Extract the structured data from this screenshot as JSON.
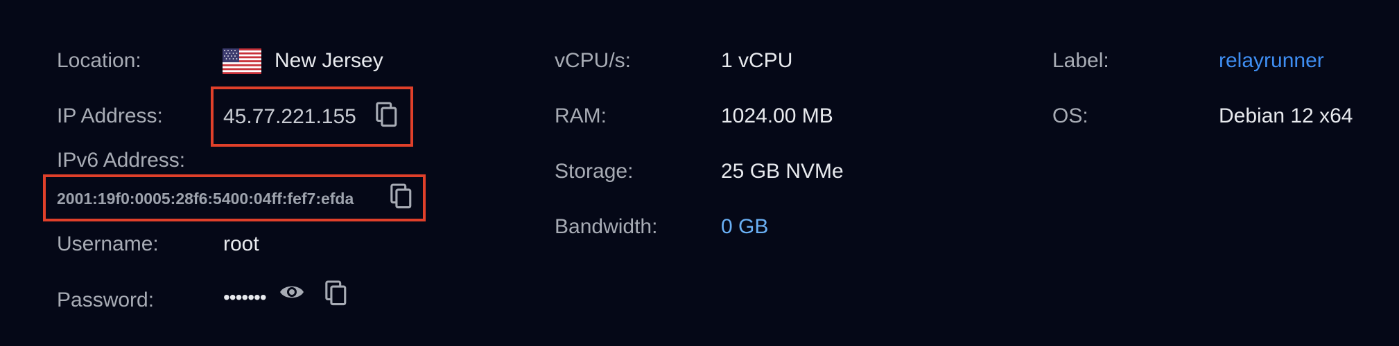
{
  "colors": {
    "background": "#050817",
    "label": "#a8acb5",
    "value": "#e8eaee",
    "link": "#3f8ef2",
    "bandwidth": "#6ab0f5",
    "highlight": "#e0402a"
  },
  "col1": {
    "location_label": "Location:",
    "location_flag_icon": "us-flag-icon",
    "location_value": "New Jersey",
    "ip_label": "IP Address:",
    "ip_value": "45.77.221.155",
    "ipv6_label": "IPv6 Address:",
    "ipv6_value": "2001:19f0:0005:28f6:5400:04ff:fef7:efda",
    "username_label": "Username:",
    "username_value": "root",
    "password_label": "Password:",
    "password_value": "•••••••"
  },
  "col2": {
    "vcpu_label": "vCPU/s:",
    "vcpu_value": "1 vCPU",
    "ram_label": "RAM:",
    "ram_value": "1024.00 MB",
    "storage_label": "Storage:",
    "storage_value": "25 GB NVMe",
    "bandwidth_label": "Bandwidth:",
    "bandwidth_value": "0 GB"
  },
  "col3": {
    "label_label": "Label:",
    "label_value": "relayrunner",
    "os_label": "OS:",
    "os_value": "Debian 12 x64"
  },
  "icons": {
    "copy": "copy-icon",
    "show_password": "eye-icon"
  }
}
